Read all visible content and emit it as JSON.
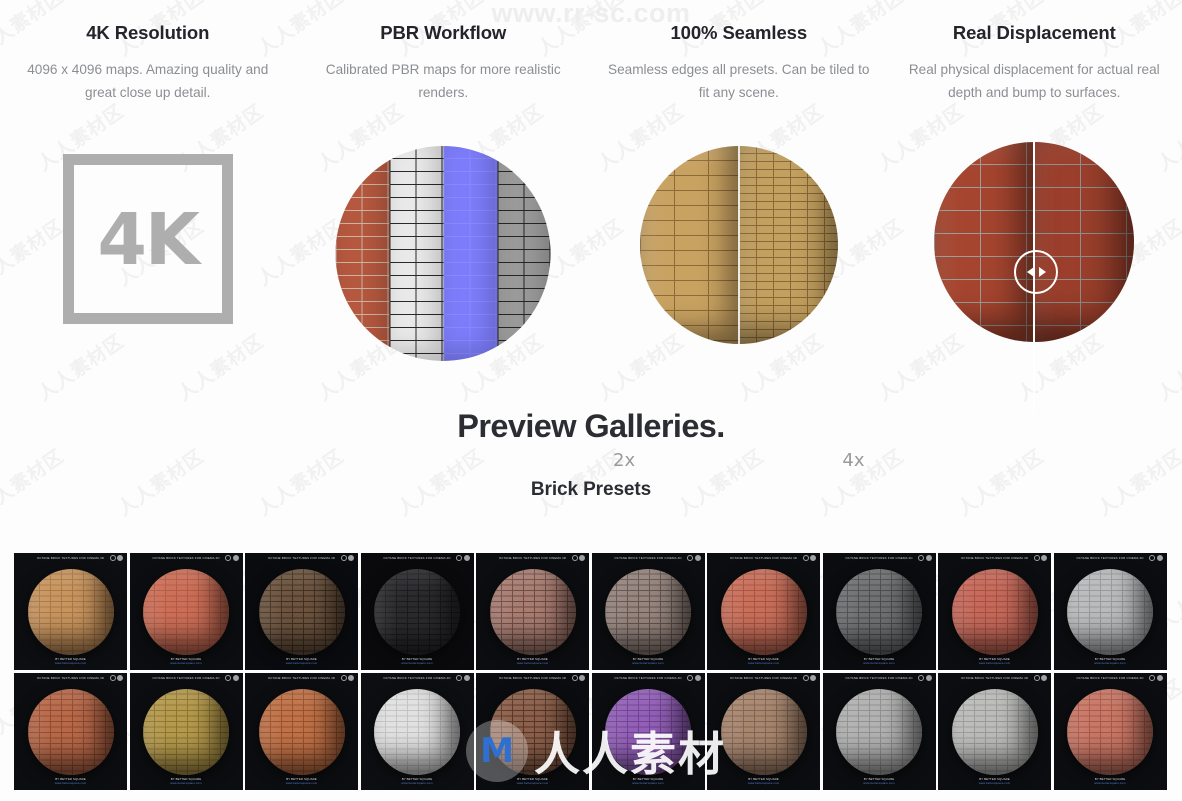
{
  "watermarks": {
    "top_url": "www.rr-sc.com",
    "center_text": "人人素材",
    "center_logo": "M",
    "tile_text": "人人素材区"
  },
  "features": [
    {
      "title": "4K Resolution",
      "desc": "4096 x 4096 maps. Amazing quality and great close up detail.",
      "icon": "4K",
      "icon_name": "four-k-badge-icon"
    },
    {
      "title": "PBR Workflow",
      "desc": "Calibrated PBR maps for more realistic renders.",
      "icon_name": "pbr-maps-sphere-icon"
    },
    {
      "title": "100% Seamless",
      "desc": "Seamless edges all presets. Can be tiled to fit any scene.",
      "icon_name": "seamless-tiling-sphere-icon",
      "labels": {
        "left": "2x",
        "right": "4x"
      }
    },
    {
      "title": "Real Displacement",
      "desc": "Real physical displacement for actual real depth and bump to surfaces.",
      "icon_name": "displacement-compare-sphere-icon"
    }
  ],
  "section": {
    "title": "Preview Galleries.",
    "subtitle": "Brick Presets"
  },
  "gallery": {
    "thumb_title": "OCTANE BRICK TEXTURES FOR CINEMA 4D",
    "thumb_footer_line1": "BY BETTER SQUARE",
    "thumb_footer_line2": "www.bettersquare.com",
    "rows": [
      [
        {
          "name": "tan-sand-brick",
          "color": "#c8955f",
          "mortar": "#a87745",
          "bg": "#0d0e11"
        },
        {
          "name": "salmon-red-brick",
          "color": "#cd6f58",
          "mortar": "#b05b45",
          "bg": "#0c0d10"
        },
        {
          "name": "dark-brown-brick",
          "color": "#6d5440",
          "mortar": "#40301f",
          "bg": "#0a0b0e"
        },
        {
          "name": "charcoal-black-brick",
          "color": "#2b2b2e",
          "mortar": "#1a1a1c",
          "bg": "#0a0a0c"
        },
        {
          "name": "mottled-rose-brick",
          "color": "#a97d72",
          "mortar": "#6e4c44",
          "bg": "#0c0d10"
        },
        {
          "name": "grey-mauve-brick",
          "color": "#97857e",
          "mortar": "#625450",
          "bg": "#0c0d10"
        },
        {
          "name": "terracotta-brick",
          "color": "#c8705c",
          "mortar": "#a8533f",
          "bg": "#0c0d10"
        },
        {
          "name": "grey-cobble-brick",
          "color": "#6f7173",
          "mortar": "#4a4c4e",
          "bg": "#0b0c0f"
        },
        {
          "name": "coral-red-brick",
          "color": "#c56a5b",
          "mortar": "#a54f42",
          "bg": "#0c0d10"
        },
        {
          "name": "light-grey-brick",
          "color": "#b9bcbd",
          "mortar": "#97999a",
          "bg": "#0c0d10"
        }
      ],
      [
        {
          "name": "rust-orange-brick",
          "color": "#b8694a",
          "mortar": "#8f4b30",
          "bg": "#0c0d10"
        },
        {
          "name": "mustard-yellow-brick",
          "color": "#b59a4c",
          "mortar": "#8c7434",
          "bg": "#0c0d10"
        },
        {
          "name": "orange-clay-brick",
          "color": "#c07248",
          "mortar": "#97512c",
          "bg": "#0c0d10"
        },
        {
          "name": "white-painted-brick",
          "color": "#e1e1e2",
          "mortar": "#c3c3c5",
          "bg": "#0d0e11"
        },
        {
          "name": "weathered-brown-brick",
          "color": "#8d604b",
          "mortar": "#543526",
          "bg": "#0b0c0f"
        },
        {
          "name": "purple-violet-brick",
          "color": "#9360b8",
          "mortar": "#6f4390",
          "bg": "#0c0d10"
        },
        {
          "name": "beige-tan-brick",
          "color": "#a8876f",
          "mortar": "#826350",
          "bg": "#0c0d10"
        },
        {
          "name": "pale-grey-brick",
          "color": "#b1b2b1",
          "mortar": "#8f908f",
          "bg": "#0c0d10"
        },
        {
          "name": "light-stone-brick",
          "color": "#bcbdbb",
          "mortar": "#9a9b99",
          "bg": "#0c0d10"
        },
        {
          "name": "pink-salmon-brick",
          "color": "#c87866",
          "mortar": "#a8584a",
          "bg": "#0c0d10"
        }
      ]
    ]
  },
  "colors": {
    "heading": "#2b2d33",
    "body_text": "#8b8e93",
    "icon_grey": "#aeaeae",
    "accent_blue": "#4d7fd6",
    "page_bg": "#fdfdfd"
  }
}
